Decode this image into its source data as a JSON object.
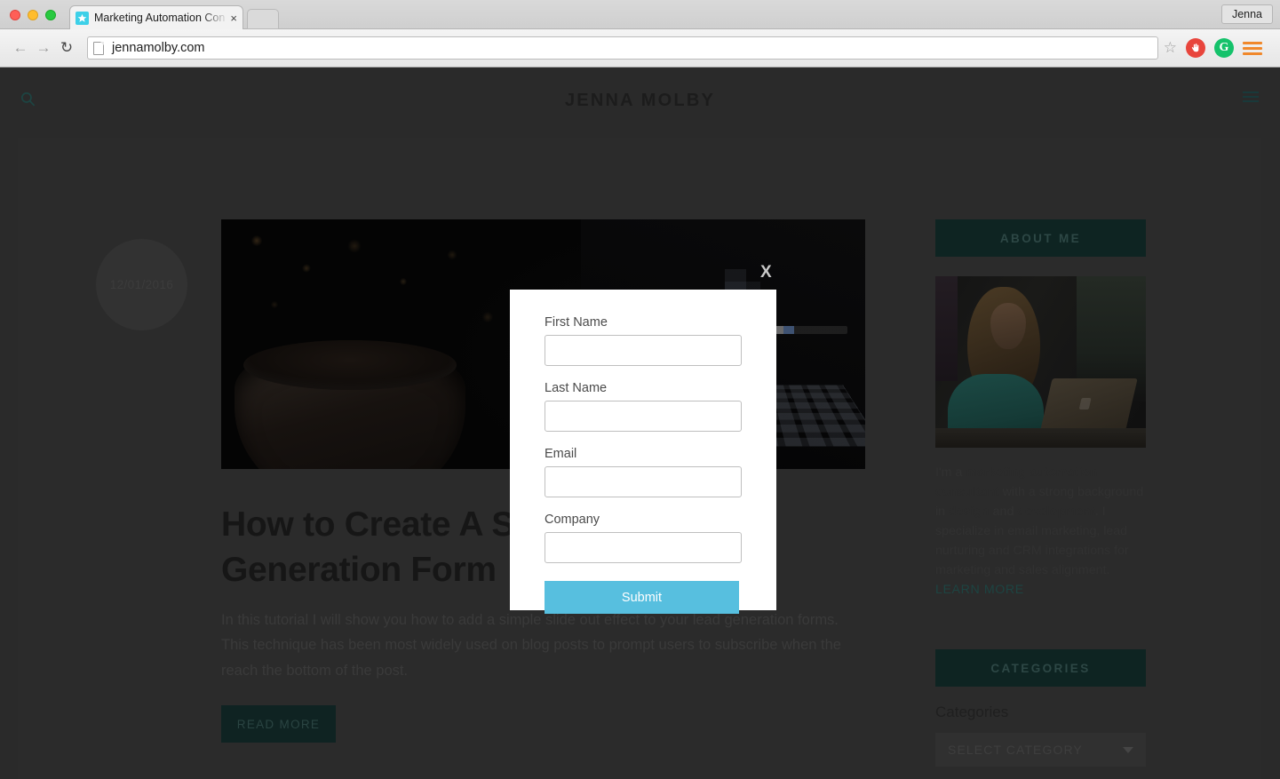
{
  "browser": {
    "tab": {
      "title": "Marketing Automation Con",
      "close_label": "×",
      "favicon": "star-icon"
    },
    "profile_label": "Jenna",
    "nav": {
      "back": "←",
      "forward": "→",
      "reload": "↻"
    },
    "url": "jennamolby.com",
    "extensions": [
      {
        "name": "adblock-icon",
        "glyph": "✋"
      },
      {
        "name": "grammarly-icon",
        "glyph": "G"
      },
      {
        "name": "chrome-menu-icon",
        "glyph": "☰"
      }
    ]
  },
  "site": {
    "logo": "JENNA MOLBY",
    "search_icon": "search-icon",
    "menu_icon": "hamburger-menu-icon"
  },
  "post": {
    "date": "12/01/2016",
    "title": "How to Create A Slide Out Lead Generation Form",
    "excerpt": "In this tutorial I will show you how to add a simple slide out effect to your lead generation forms. This technique has been most widely used on blog posts to prompt users to subscribe when the reach the bottom of the post.",
    "read_more": "READ MORE"
  },
  "sidebar": {
    "about": {
      "heading": "ABOUT ME",
      "intro_1": "I'm a ",
      "bold_1": "marketing automation consultant",
      "intro_2": " with a strong background in ",
      "bold_2": "design",
      "intro_3": " and ",
      "bold_3": "development",
      "intro_4": ". I specialize in email marketing, lead nurturing and CRM integrations for marketing and sales alignment.",
      "learn_more": "LEARN MORE"
    },
    "categories": {
      "heading": "CATEGORIES",
      "label": "Categories",
      "selected": "SELECT CATEGORY"
    }
  },
  "modal": {
    "close_label": "X",
    "fields": [
      {
        "label": "First Name",
        "value": "",
        "placeholder": ""
      },
      {
        "label": "Last Name",
        "value": "",
        "placeholder": ""
      },
      {
        "label": "Email",
        "value": "",
        "placeholder": ""
      },
      {
        "label": "Company",
        "value": "",
        "placeholder": ""
      }
    ],
    "submit_label": "Submit"
  },
  "colors": {
    "accent_blue": "#57bfdf",
    "brand_dark_green": "#0e2422",
    "page_bg": "#2a2a2a"
  }
}
